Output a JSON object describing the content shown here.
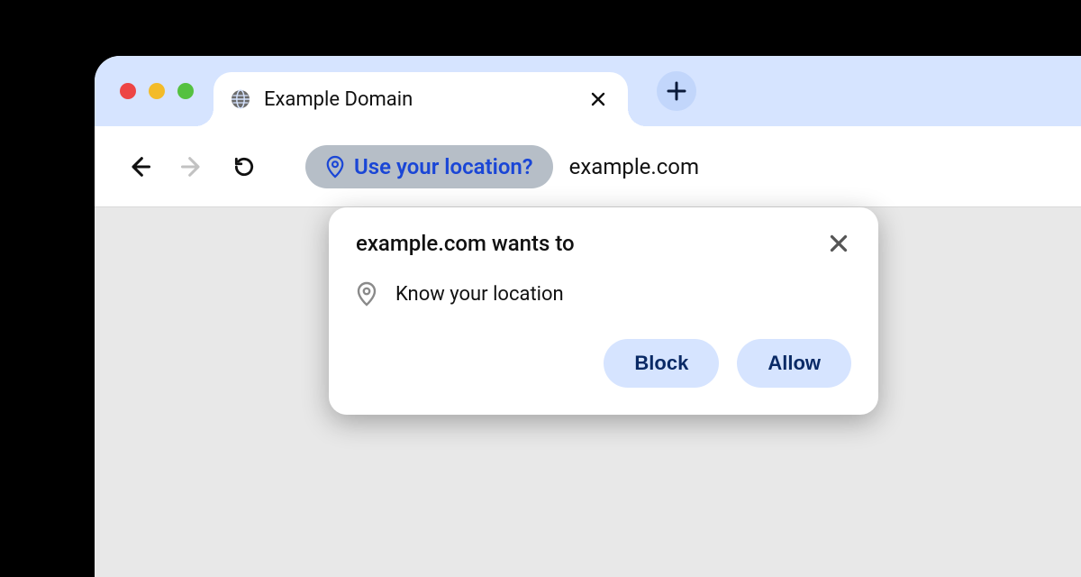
{
  "tab": {
    "title": "Example Domain"
  },
  "toolbar": {
    "permission_chip_label": "Use your location?",
    "url": "example.com"
  },
  "popover": {
    "title": "example.com wants to",
    "permission_text": "Know your location",
    "block_label": "Block",
    "allow_label": "Allow"
  },
  "colors": {
    "accent_bg": "#d6e4ff",
    "link_blue": "#1a46d6",
    "dark_text": "#0a2a66"
  }
}
